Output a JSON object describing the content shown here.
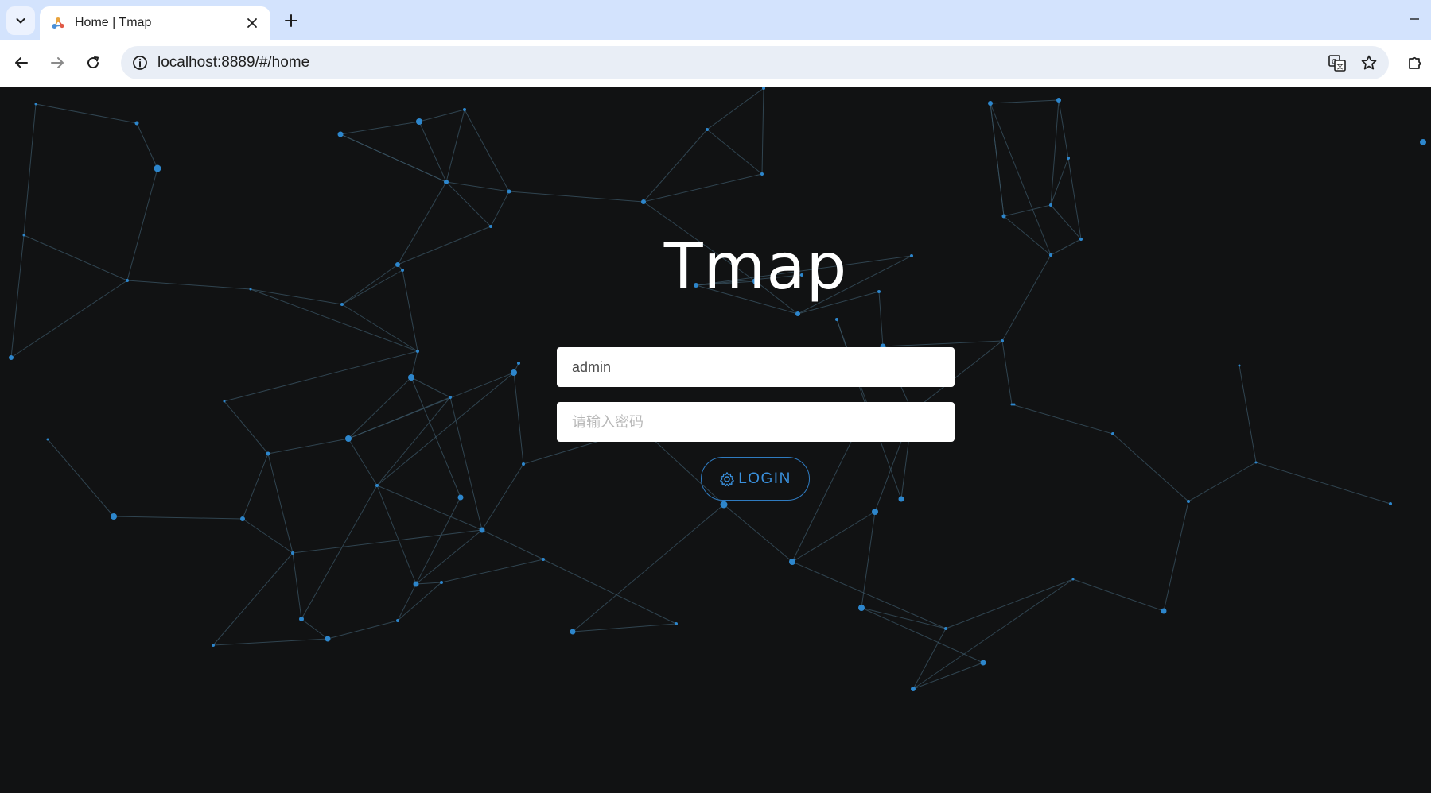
{
  "browser": {
    "tab_title": "Home | Tmap",
    "url": "localhost:8889/#/home"
  },
  "page": {
    "app_title": "Tmap",
    "username_value": "admin",
    "password_placeholder": "请输入密码",
    "login_label": "LOGIN"
  },
  "icons": {
    "tab_dropdown": "chevron-down-icon",
    "favicon": "tmap-logo-icon",
    "close": "close-icon",
    "new_tab": "plus-icon",
    "back": "arrow-left-icon",
    "forward": "arrow-right-icon",
    "reload": "reload-icon",
    "site_info": "info-icon",
    "translate": "translate-icon",
    "bookmark": "star-icon",
    "extensions": "puzzle-icon",
    "login": "gear-icon"
  },
  "colors": {
    "background": "#111213",
    "node": "#2d86cc",
    "link": "#3b5566",
    "accent": "#3a90dc"
  }
}
